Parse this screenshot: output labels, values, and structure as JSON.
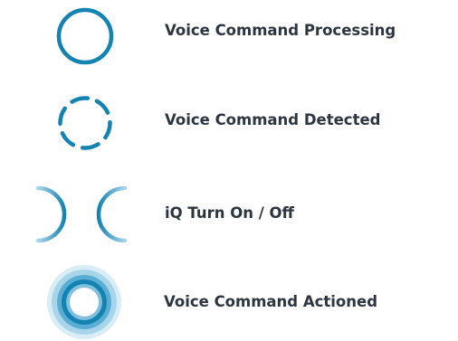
{
  "colors": {
    "accent": "#1583b2",
    "accent_light": "#a9d5ea",
    "text": "#2d3540"
  },
  "legend": {
    "processing": {
      "icon": "solid-circle-icon",
      "label": "Voice Command Processing"
    },
    "detected": {
      "icon": "dashed-circle-icon",
      "label": "Voice Command Detected"
    },
    "turn_on_off": {
      "icon": "split-circle-icon",
      "label": "iQ Turn On / Off"
    },
    "actioned": {
      "icon": "concentric-rings-icon",
      "label": "Voice Command Actioned"
    }
  }
}
